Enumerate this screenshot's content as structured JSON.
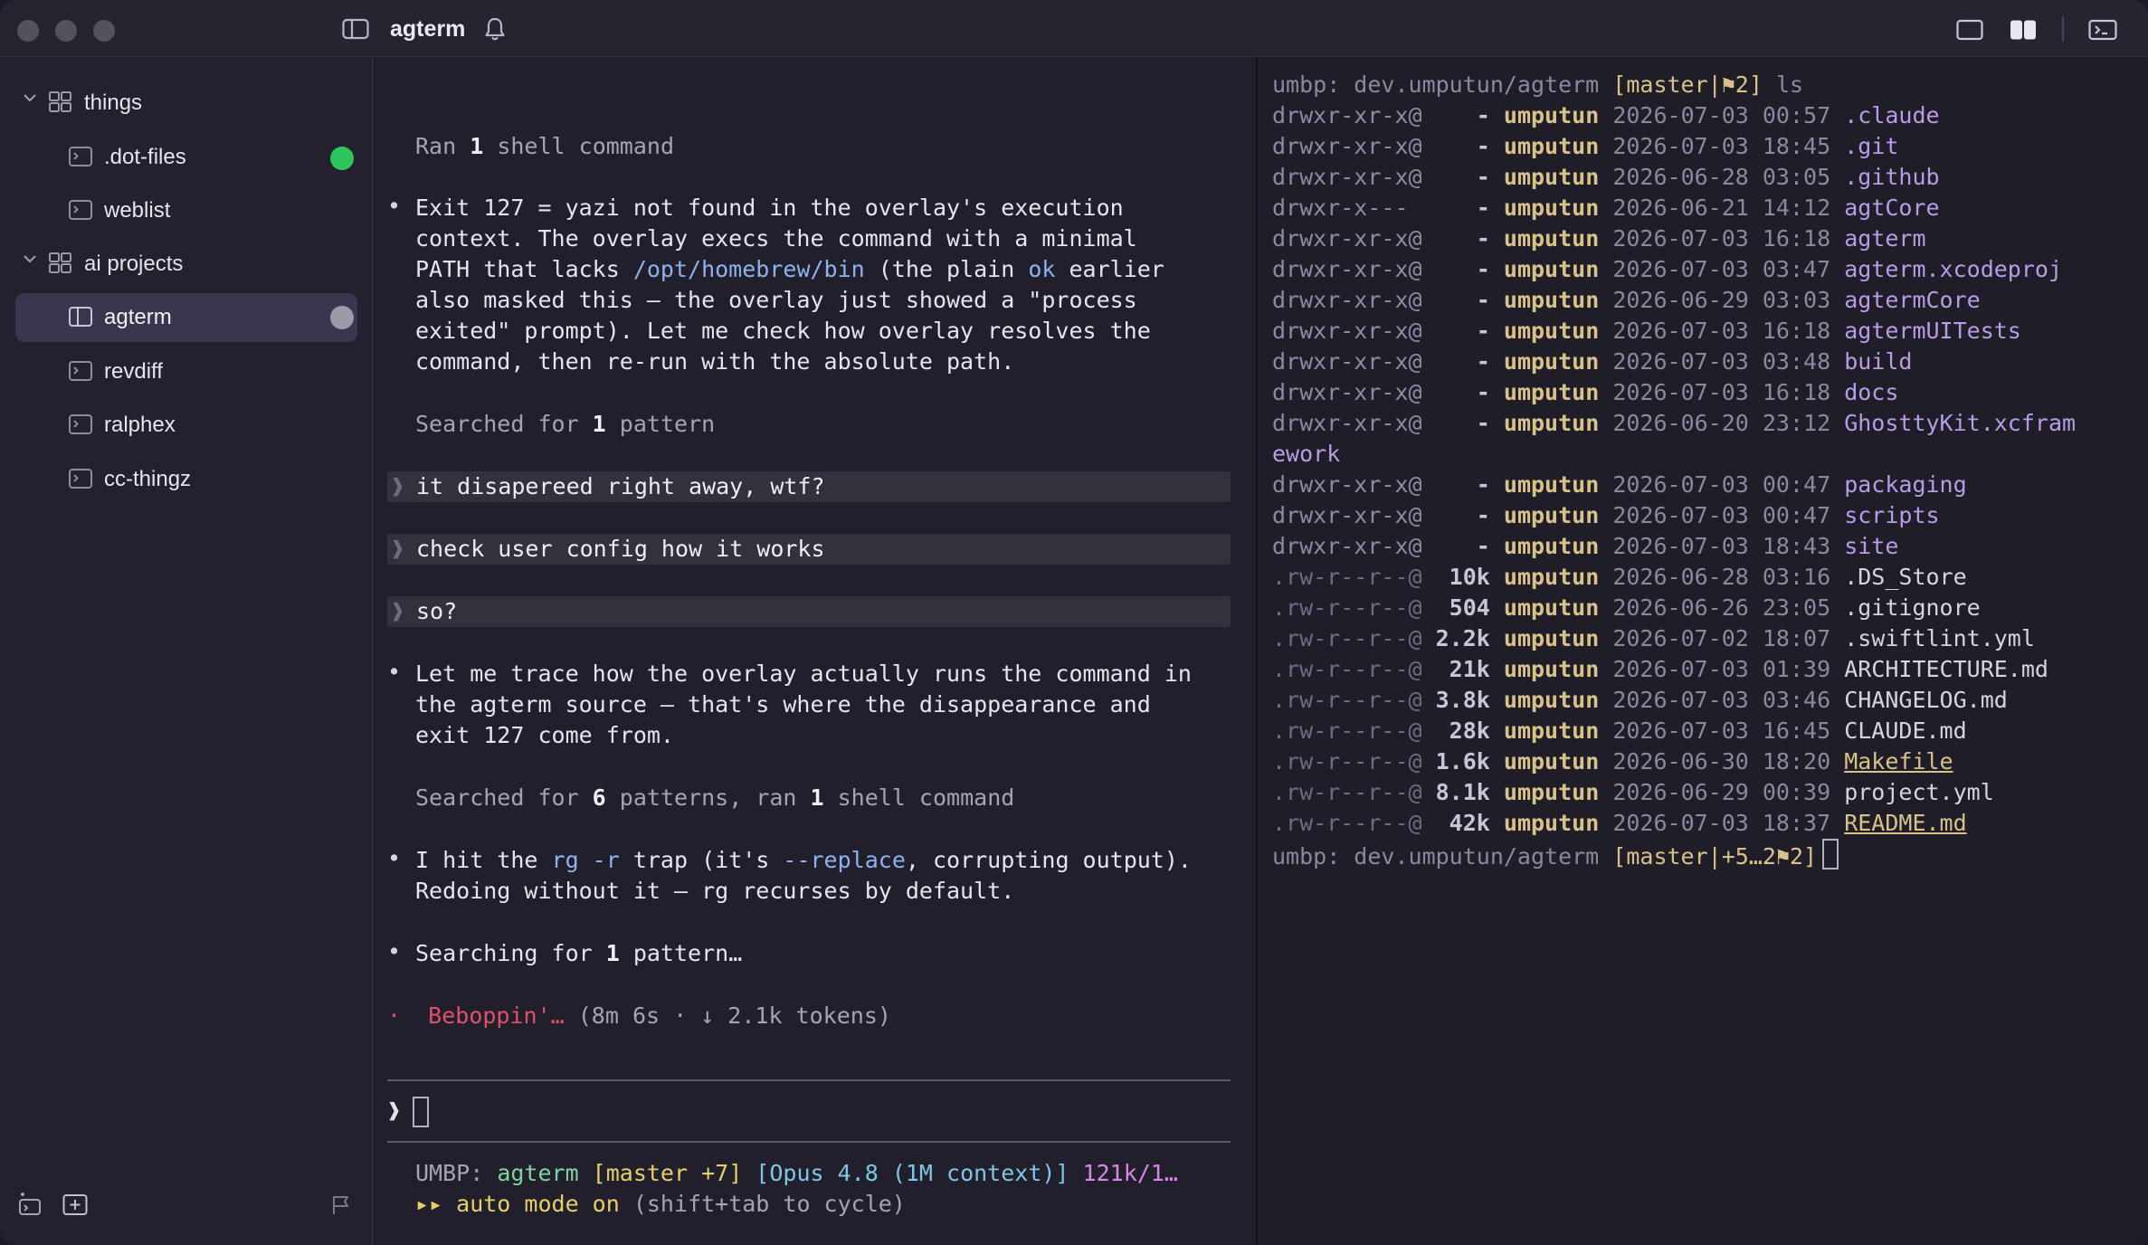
{
  "window": {
    "title": "agterm",
    "icons": [
      "sidebar-toggle-icon",
      "bell-icon",
      "single-pane-icon",
      "split-pane-icon",
      "terminal-icon"
    ]
  },
  "sidebar": {
    "groups": [
      {
        "label": "things",
        "items": [
          {
            "label": ".dot-files",
            "status": "#2ec55f"
          },
          {
            "label": "weblist",
            "status": ""
          }
        ]
      },
      {
        "label": "ai projects",
        "items": [
          {
            "label": "agterm",
            "status": "#9c99a8",
            "selected": true
          },
          {
            "label": "revdiff",
            "status": ""
          },
          {
            "label": "ralphex",
            "status": ""
          },
          {
            "label": "cc-thingz",
            "status": ""
          }
        ]
      }
    ],
    "bottom_icons": [
      "new-session-icon",
      "add-icon",
      "flag-icon"
    ]
  },
  "chat": {
    "ran_cmd": "Ran 1 shell command",
    "ran_cmd_parts": [
      "Ran ",
      "1",
      " shell command"
    ],
    "p1": {
      "l1": "Exit 127 = yazi not found in the overlay's execution",
      "l2": "context. The overlay execs the command with a minimal",
      "l3a": "PATH that lacks ",
      "l3b": "/opt/homebrew/bin",
      "l3c": " (the plain ",
      "l3d": "ok",
      "l3e": " earlier",
      "l4": "also masked this — the overlay just showed a \"process",
      "l5": "exited\" prompt). Let me check how overlay resolves the",
      "l6": "command, then re-run with the absolute path."
    },
    "searched1": {
      "a": "Searched for ",
      "b": "1",
      "c": " pattern"
    },
    "prompts": [
      "it disapereed right away, wtf?",
      "check user config how it works",
      "so?"
    ],
    "p2": {
      "l1": "Let me trace how the overlay actually runs the command in",
      "l2": "the agterm source — that's where the disappearance and",
      "l3": "exit 127 come from."
    },
    "searched2": {
      "a": "Searched for ",
      "b": "6",
      "c": " patterns, ran ",
      "d": "1",
      "e": " shell command"
    },
    "p3": {
      "l1a": "I hit the ",
      "l1b": "rg -r",
      "l1c": " trap (it's ",
      "l1d": "--replace",
      "l1e": ", corrupting output).",
      "l2": "Redoing without it — rg recurses by default."
    },
    "searching": {
      "a": "Searching for ",
      "b": "1",
      "c": " pattern…"
    },
    "status_line": {
      "spinner": "·",
      "verb": "Beboppin'…",
      "meta": " (8m 6s · ↓ 2.1k tokens)"
    },
    "input_caret": "❱",
    "statusbar": {
      "host": "UMBP: ",
      "project": "agterm",
      "branch": " [master +7]",
      "model": " [Opus 4.8 (1M context)]",
      "tokens": " 121k/1…",
      "mode_arrows": "▸▸ ",
      "mode": "auto mode on",
      "mode_hint": " (shift+tab to cycle)"
    }
  },
  "terminal": {
    "prompt": {
      "host": "umbp: dev.umputun/agterm ",
      "branch": "[master|",
      "flag": "⚑2",
      "close": "]",
      "cmd": " ls"
    },
    "rows": [
      {
        "perm": "drwxr-xr-x@",
        "size": "-",
        "owner": "umputun",
        "date": "2026-07-03 00:57",
        "name": ".claude",
        "kind": "dir"
      },
      {
        "perm": "drwxr-xr-x@",
        "size": "-",
        "owner": "umputun",
        "date": "2026-07-03 18:45",
        "name": ".git",
        "kind": "dir"
      },
      {
        "perm": "drwxr-xr-x@",
        "size": "-",
        "owner": "umputun",
        "date": "2026-06-28 03:05",
        "name": ".github",
        "kind": "dir"
      },
      {
        "perm": "drwxr-x---",
        "size": "-",
        "owner": "umputun",
        "date": "2026-06-21 14:12",
        "name": "agtCore",
        "kind": "dir"
      },
      {
        "perm": "drwxr-xr-x@",
        "size": "-",
        "owner": "umputun",
        "date": "2026-07-03 16:18",
        "name": "agterm",
        "kind": "dir"
      },
      {
        "perm": "drwxr-xr-x@",
        "size": "-",
        "owner": "umputun",
        "date": "2026-07-03 03:47",
        "name": "agterm.xcodeproj",
        "kind": "dir"
      },
      {
        "perm": "drwxr-xr-x@",
        "size": "-",
        "owner": "umputun",
        "date": "2026-06-29 03:03",
        "name": "agtermCore",
        "kind": "dir"
      },
      {
        "perm": "drwxr-xr-x@",
        "size": "-",
        "owner": "umputun",
        "date": "2026-07-03 16:18",
        "name": "agtermUITests",
        "kind": "dir"
      },
      {
        "perm": "drwxr-xr-x@",
        "size": "-",
        "owner": "umputun",
        "date": "2026-07-03 03:48",
        "name": "build",
        "kind": "dir"
      },
      {
        "perm": "drwxr-xr-x@",
        "size": "-",
        "owner": "umputun",
        "date": "2026-07-03 16:18",
        "name": "docs",
        "kind": "dir"
      },
      {
        "perm": "drwxr-xr-x@",
        "size": "-",
        "owner": "umputun",
        "date": "2026-06-20 23:12",
        "name": "GhosttyKit.xcfram",
        "wrap": "ework",
        "kind": "dir"
      },
      {
        "perm": "drwxr-xr-x@",
        "size": "-",
        "owner": "umputun",
        "date": "2026-07-03 00:47",
        "name": "packaging",
        "kind": "dir"
      },
      {
        "perm": "drwxr-xr-x@",
        "size": "-",
        "owner": "umputun",
        "date": "2026-07-03 00:47",
        "name": "scripts",
        "kind": "dir"
      },
      {
        "perm": "drwxr-xr-x@",
        "size": "-",
        "owner": "umputun",
        "date": "2026-07-03 18:43",
        "name": "site",
        "kind": "dir"
      },
      {
        "perm": ".rw-r--r--@",
        "size": "10k",
        "owner": "umputun",
        "date": "2026-06-28 03:16",
        "name": ".DS_Store",
        "kind": "file"
      },
      {
        "perm": ".rw-r--r--@",
        "size": "504",
        "owner": "umputun",
        "date": "2026-06-26 23:05",
        "name": ".gitignore",
        "kind": "file"
      },
      {
        "perm": ".rw-r--r--@",
        "size": "2.2k",
        "owner": "umputun",
        "date": "2026-07-02 18:07",
        "name": ".swiftlint.yml",
        "kind": "file"
      },
      {
        "perm": ".rw-r--r--@",
        "size": "21k",
        "owner": "umputun",
        "date": "2026-07-03 01:39",
        "name": "ARCHITECTURE.md",
        "kind": "file"
      },
      {
        "perm": ".rw-r--r--@",
        "size": "3.8k",
        "owner": "umputun",
        "date": "2026-07-03 03:46",
        "name": "CHANGELOG.md",
        "kind": "file"
      },
      {
        "perm": ".rw-r--r--@",
        "size": "28k",
        "owner": "umputun",
        "date": "2026-07-03 16:45",
        "name": "CLAUDE.md",
        "kind": "file"
      },
      {
        "perm": ".rw-r--r--@",
        "size": "1.6k",
        "owner": "umputun",
        "date": "2026-06-30 18:20",
        "name": "Makefile",
        "kind": "link"
      },
      {
        "perm": ".rw-r--r--@",
        "size": "8.1k",
        "owner": "umputun",
        "date": "2026-06-29 00:39",
        "name": "project.yml",
        "kind": "file"
      },
      {
        "perm": ".rw-r--r--@",
        "size": "42k",
        "owner": "umputun",
        "date": "2026-07-03 18:37",
        "name": "README.md",
        "kind": "link"
      }
    ],
    "prompt2": {
      "host": "umbp: dev.umputun/agterm ",
      "branch": "[master|",
      "dirty": "+5…2",
      "flag": "⚑2",
      "close": "]"
    }
  },
  "colors": {
    "background": "#22202c",
    "selected": "#3a3650",
    "status_green": "#2ec55f",
    "accent_red": "#e0506a",
    "link_blue": "#8eb2ee",
    "dir_purple": "#b89ce6",
    "owner_yellow": "#d9c28a"
  }
}
